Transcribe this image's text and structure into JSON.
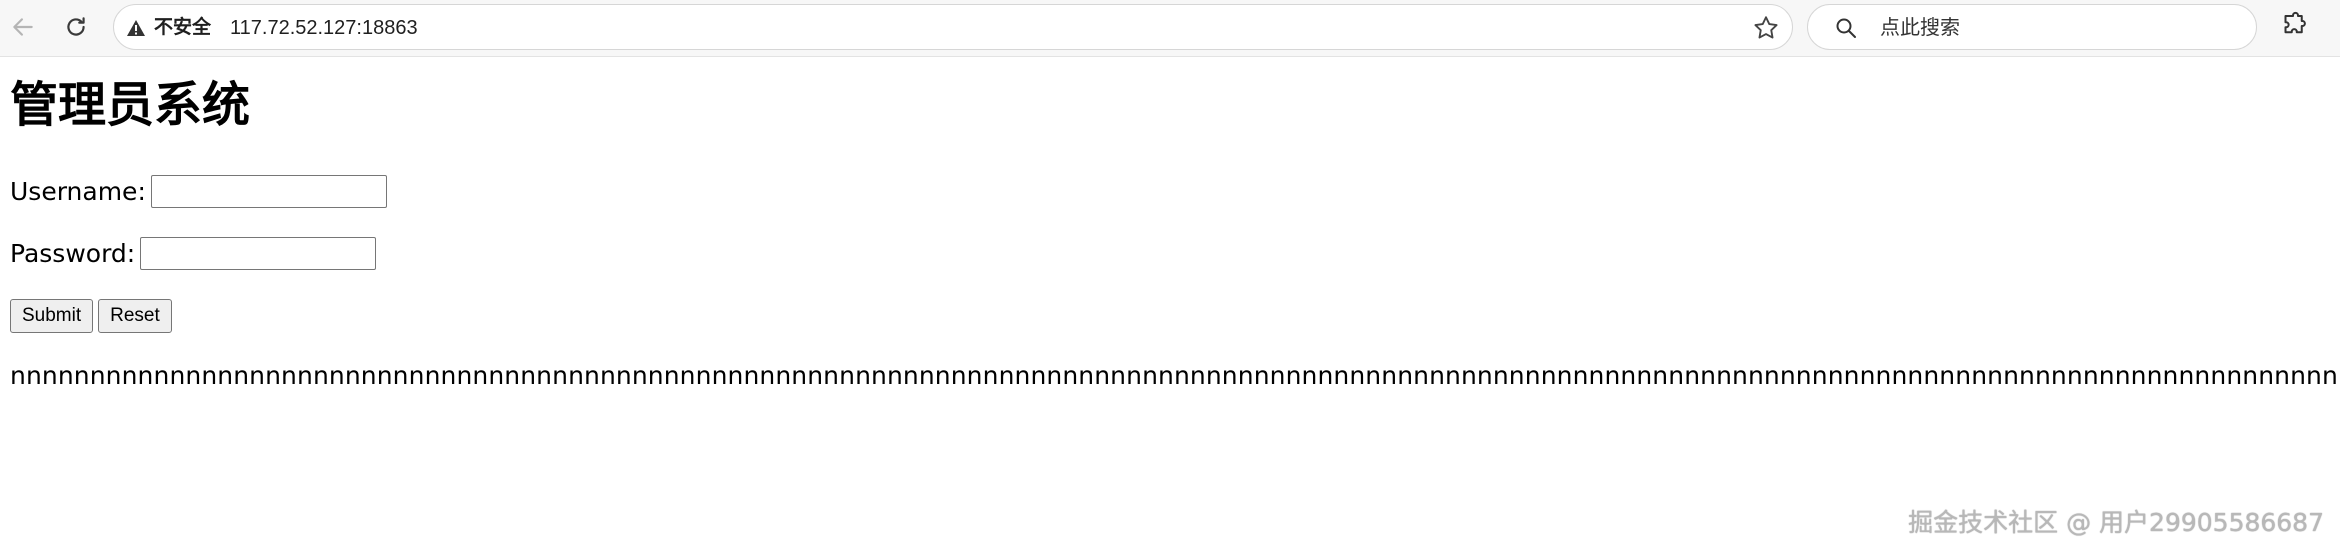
{
  "browser": {
    "security_label": "不安全",
    "url": "117.72.52.127:18863",
    "search_placeholder": "点此搜索"
  },
  "page": {
    "title": "管理员系统",
    "username_label": "Username:",
    "username_value": "",
    "password_label": "Password:",
    "password_value": "",
    "submit_label": "Submit",
    "reset_label": "Reset",
    "filler_text": "nnnnnnnnnnnnnnnnnnnnnnnnnnnnnnnnnnnnnnnnnnnnnnnnnnnnnnnnnnnnnnnnnnnnnnnnnnnnnnnnnnnnnnnnnnnnnnnnnnnnnnnnnnnnnnnnnnnnnnnnnnnnnnnnnnnnnnnnnnnnnnnnnnnnnnnnnnnnnnnnnnnnnnnnnnnnnnnnnnnnnnnnnnnnnnnnnnnnnnnnnnnnnnnnnnnnnnnnnnnnnnnnnnnnnnnnnn"
  },
  "watermark": "掘金技术社区 @ 用户29905586687"
}
